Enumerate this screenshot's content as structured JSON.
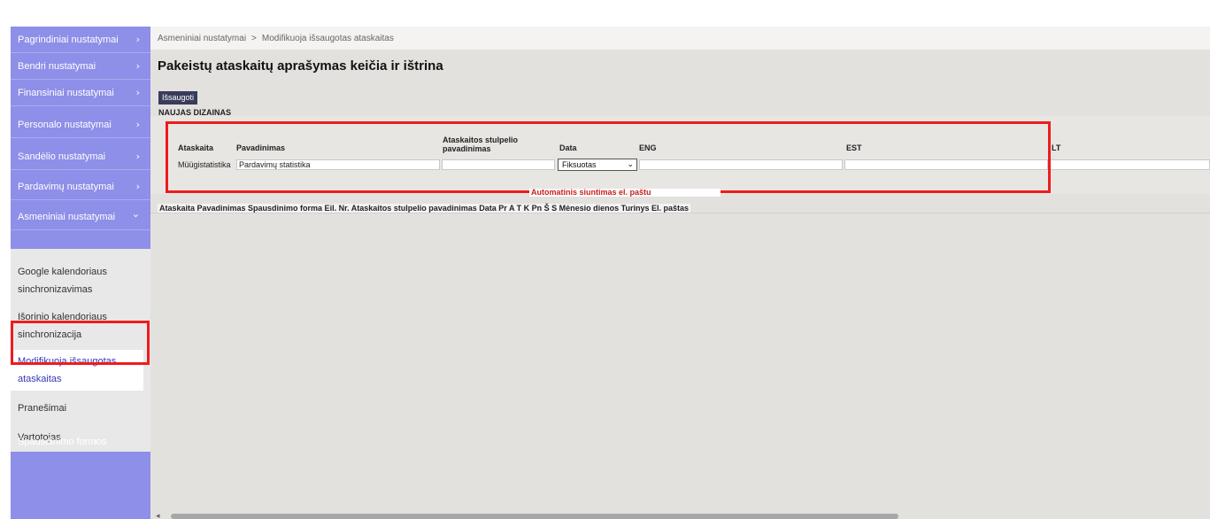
{
  "sidebar": {
    "items": [
      {
        "label": "Pagrindiniai nustatymai",
        "chevron": "›"
      },
      {
        "label": "Bendri nustatymai",
        "chevron": "›"
      },
      {
        "label": "Finansiniai nustatymai",
        "chevron": "›"
      },
      {
        "label": "Personalo nustatymai",
        "chevron": "›"
      },
      {
        "label": "Sandėlio nustatymai",
        "chevron": "›"
      },
      {
        "label": "Pardavimų nustatymai",
        "chevron": "›"
      },
      {
        "label": "Asmeniniai nustatymai",
        "chevron": "⌄"
      }
    ],
    "sub_items": [
      {
        "label": "Google kalendoriaus sinchronizavimas"
      },
      {
        "label": "Išorinio kalendoriaus sinchronizacija"
      },
      {
        "label": "Modifikuoja išsaugotas ataskaitas"
      },
      {
        "label": "Pranešimai"
      },
      {
        "label": "Vartotojas"
      }
    ],
    "bottom_item": {
      "label": "Spausdinimo formos",
      "chevron": "›"
    }
  },
  "breadcrumb": {
    "parent": "Asmeniniai nustatymai",
    "separator": ">",
    "current": "Modifikuoja išsaugotas ataskaitas"
  },
  "page_title": "Pakeistų ataskaitų aprašymas keičia ir ištrina",
  "save_label": "Išsaugoti",
  "section_title": "NAUJAS DIZAINAS",
  "form": {
    "headers": {
      "report": "Ataskaita",
      "name": "Pavadinimas",
      "column_name": "Ataskaitos stulpelio pavadinimas",
      "date": "Data",
      "eng": "ENG",
      "est": "EST",
      "lt": "LT"
    },
    "row": {
      "report": "Müügistatistika",
      "name": "Pardavimų statistika",
      "column_name": "",
      "date": "Fiksuotas",
      "eng": "",
      "est": "",
      "lt": ""
    }
  },
  "auto_send_title": "Automatinis siuntimas el. paštu",
  "columns_row": "Ataskaita Pavadinimas Spausdinimo forma Eil. Nr. Ataskaitos stulpelio pavadinimas Data Pr A T K Pn Š S Mėnesio dienos Turinys El. paštas",
  "colors": {
    "sidebar": "#8d8fe8",
    "highlight": "#ee1c1c",
    "active_link": "#3338b8"
  }
}
